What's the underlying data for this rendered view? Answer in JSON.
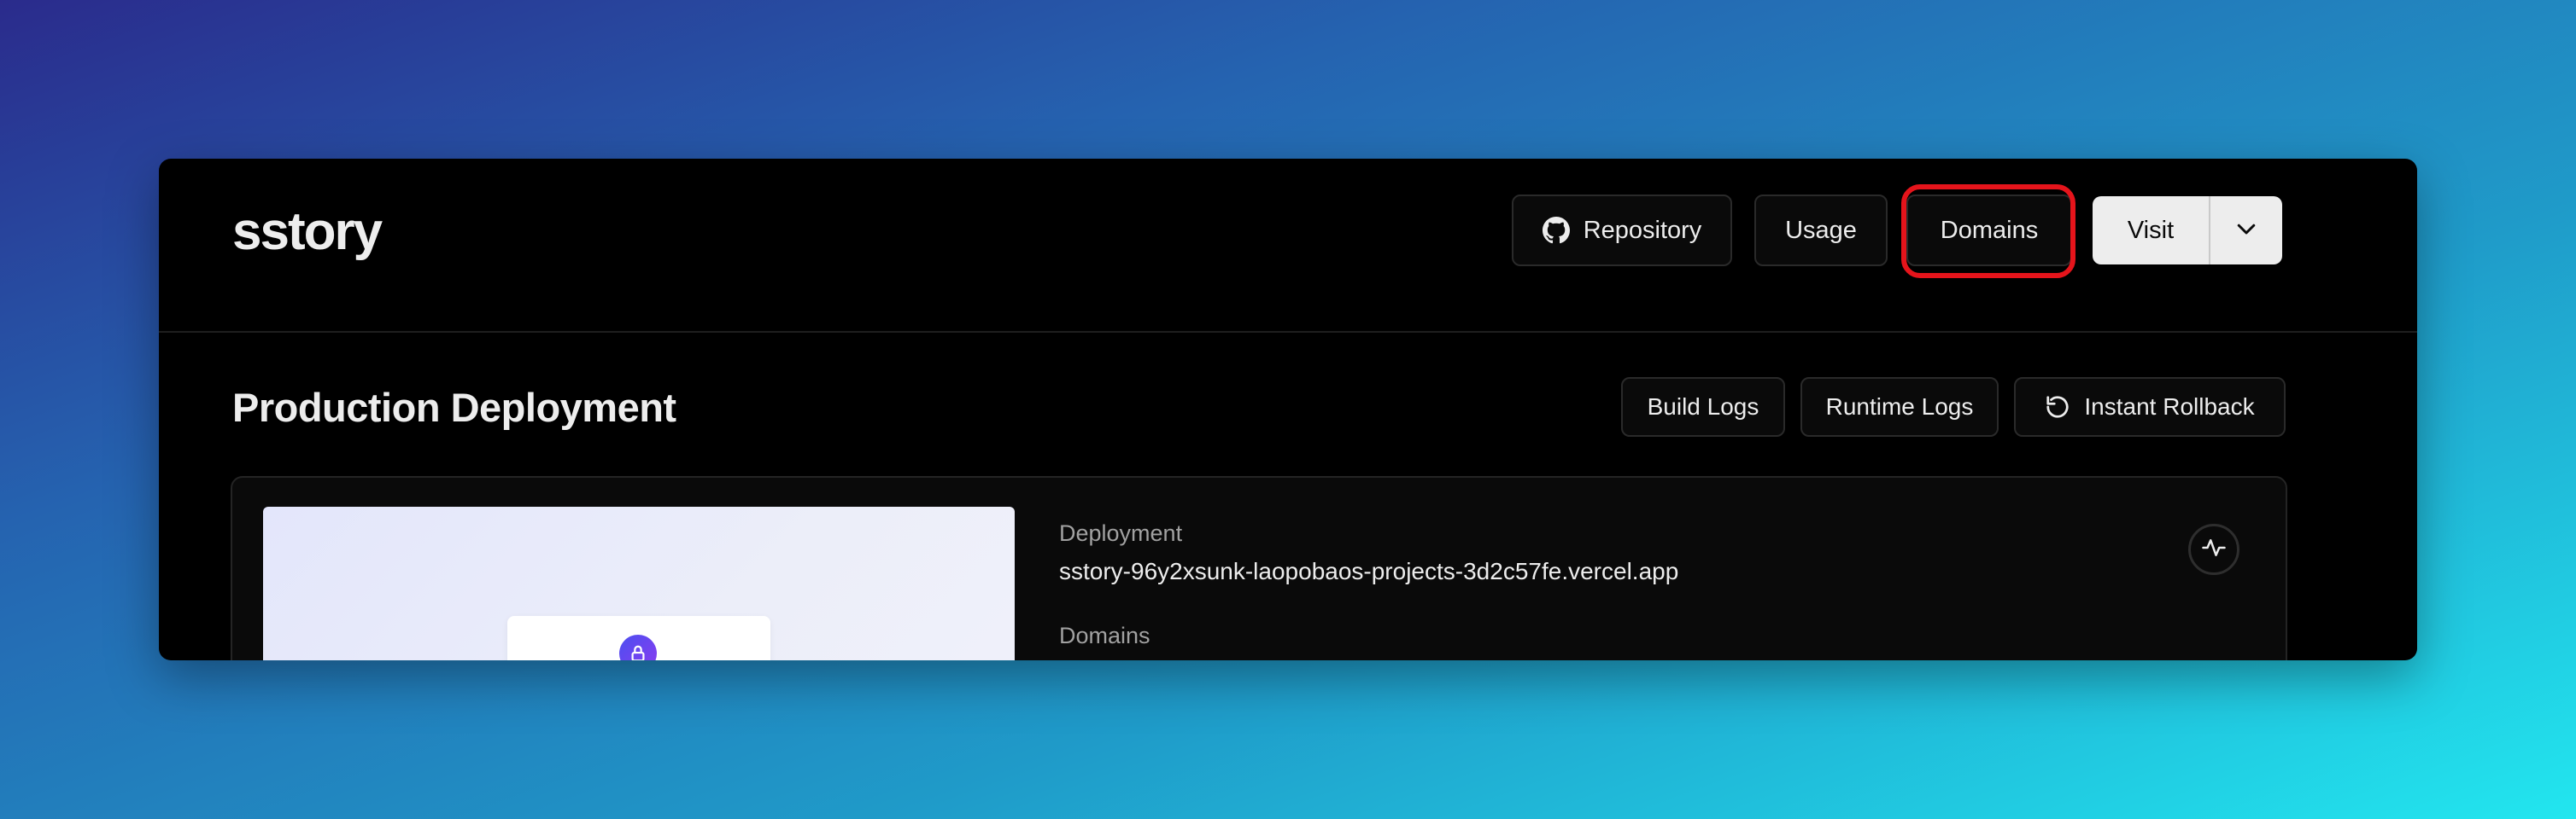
{
  "header": {
    "project_name": "sstory",
    "nav": {
      "repository_label": "Repository",
      "usage_label": "Usage",
      "domains_label": "Domains",
      "visit_label": "Visit"
    },
    "icons": {
      "repository": "github-icon",
      "visit_menu": "chevron-down-icon"
    },
    "highlight_color": "#e5141b"
  },
  "production": {
    "title": "Production Deployment",
    "actions": {
      "build_logs_label": "Build Logs",
      "runtime_logs_label": "Runtime Logs",
      "rollback_label": "Instant Rollback"
    },
    "card": {
      "deployment_label": "Deployment",
      "deployment_url": "sstory-96y2xsunk-laopobaos-projects-3d2c57fe.vercel.app",
      "domains_label": "Domains",
      "preview_icon": "lock-icon",
      "status_icon": "activity-icon"
    }
  },
  "colors": {
    "window_bg": "#000000",
    "text_primary": "#ededed",
    "text_secondary": "#a1a1a1",
    "lock_badge": "#6b46f0"
  }
}
